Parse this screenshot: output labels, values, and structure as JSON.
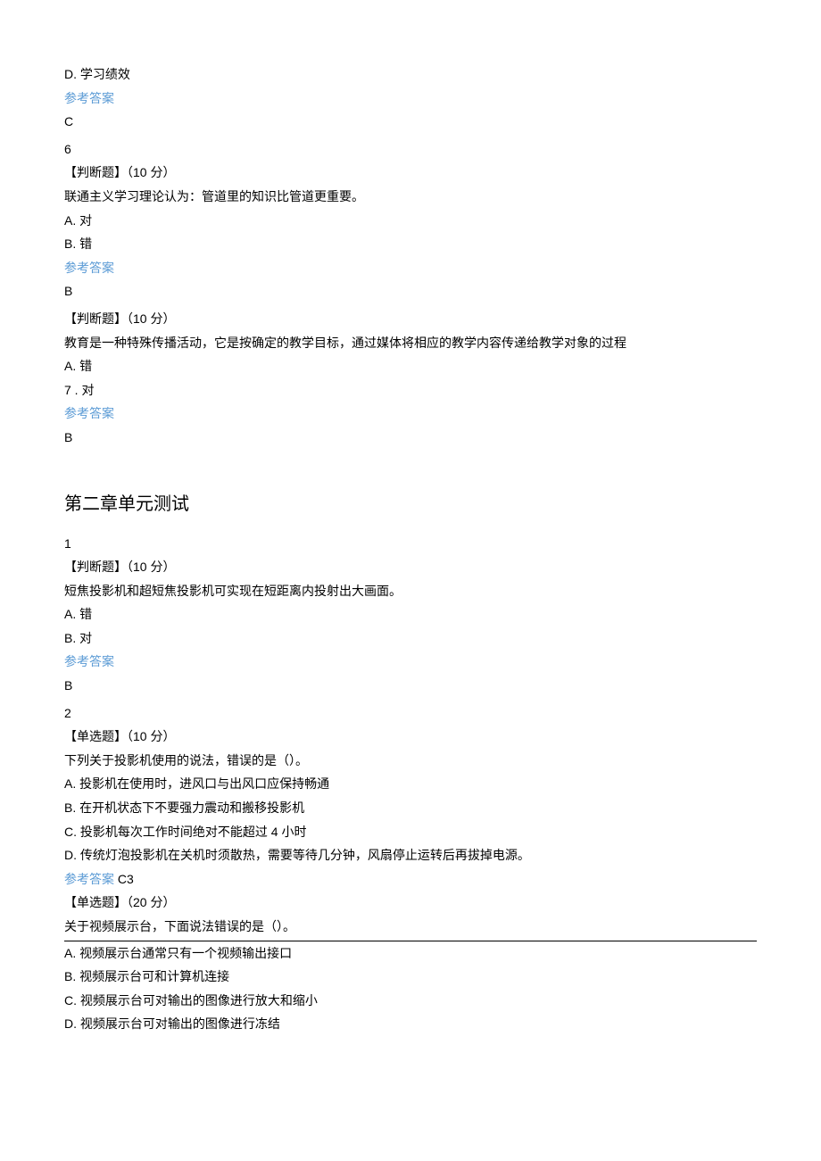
{
  "q5": {
    "optD": "D. 学习绩效",
    "ansLabel": "参考答案",
    "ansText": "C"
  },
  "q6": {
    "num": "6",
    "typeLine": "【判断题】（10 分）",
    "stem": "联通主义学习理论认为：管道里的知识比管道更重要。",
    "optA": "A. 对",
    "optB": "B. 错",
    "ansLabel": "参考答案",
    "ansText": "B"
  },
  "q7": {
    "typeLine": "【判断题】（10 分）",
    "stem": "教育是一种特殊传播活动，它是按确定的教学目标，通过媒体将相应的教学内容传递给教学对象的过程",
    "optA": "A. 错",
    "optB": "7   . 对",
    "ansLabel": "参考答案",
    "ansText": "B"
  },
  "chapter2": "第二章单元测试",
  "c2q1": {
    "num": "1",
    "typeLine": "【判断题】（10 分）",
    "stem": "短焦投影机和超短焦投影机可实现在短距离内投射出大画面。",
    "optA": "A. 错",
    "optB": "B. 对",
    "ansLabel": "参考答案",
    "ansText": "B"
  },
  "c2q2": {
    "num": "2",
    "typeLine": "【单选题】（10 分）",
    "stem": "下列关于投影机使用的说法，错误的是（）。",
    "optA": "A. 投影机在使用时，进风口与出风口应保持畅通",
    "optB": "B. 在开机状态下不要强力震动和搬移投影机",
    "optC": "C. 投影机每次工作时间绝对不能超过 4 小时",
    "optD": "D. 传统灯泡投影机在关机时须散热，需要等待几分钟，风扇停止运转后再拔掉电源。",
    "ansLabel": "参考答案",
    "ansInline": " C3"
  },
  "c2q3": {
    "typeLine": "【单选题】（20 分）",
    "stem": "关于视频展示台，下面说法错误的是（）。",
    "optA": "A. 视频展示台通常只有一个视频输出接口",
    "optB": "B. 视频展示台可和计算机连接",
    "optC": "C. 视频展示台可对输出的图像进行放大和缩小",
    "optD": "D. 视频展示台可对输出的图像进行冻结"
  }
}
